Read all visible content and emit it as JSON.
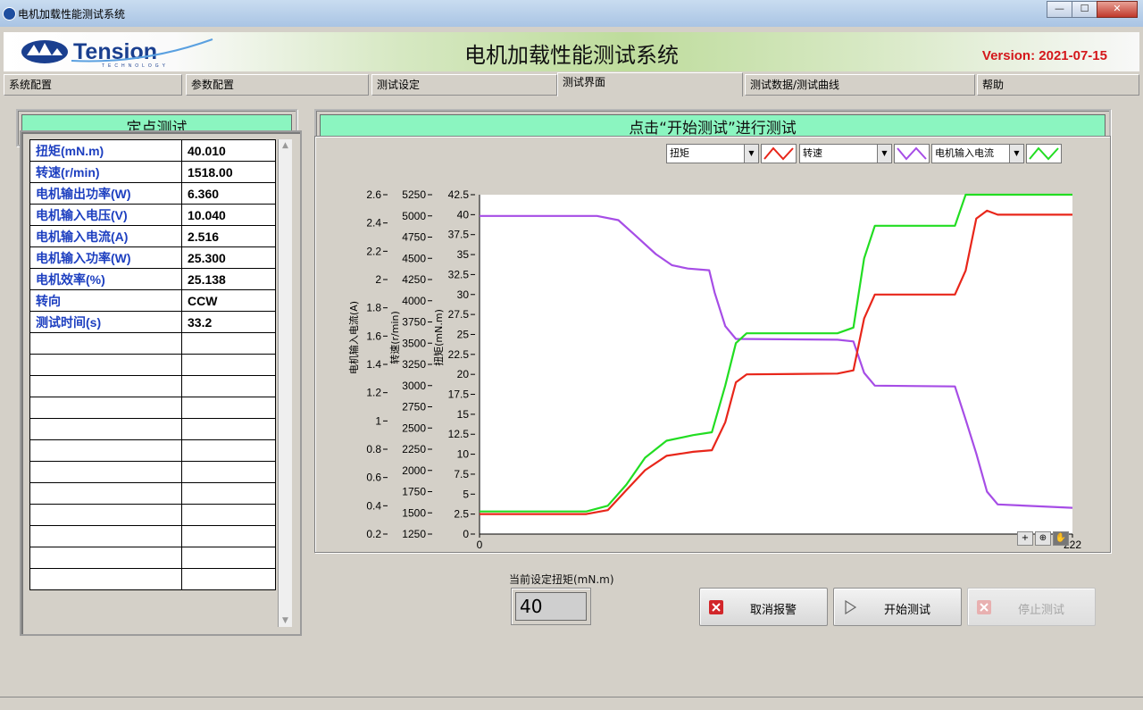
{
  "window": {
    "title": "电机加载性能测试系统",
    "min": "—",
    "max": "☐",
    "close": "✕"
  },
  "header": {
    "logo_text": "Tension",
    "logo_sub": "TECHNOLOGY",
    "title": "电机加载性能测试系统",
    "version": "Version: 2021-07-15"
  },
  "tabs": [
    "系统配置",
    "参数配置",
    "测试设定",
    "测试界面",
    "测试数据/测试曲线",
    "帮助"
  ],
  "active_tab": "测试界面",
  "left_panel": {
    "title": "定点测试"
  },
  "right_panel": {
    "title": "点击“开始测试”进行测试"
  },
  "table": {
    "rows": [
      {
        "label": "扭矩(mN.m)",
        "value": "40.010"
      },
      {
        "label": "转速(r/min)",
        "value": "1518.00"
      },
      {
        "label": "电机输出功率(W)",
        "value": "6.360"
      },
      {
        "label": "电机输入电压(V)",
        "value": "10.040"
      },
      {
        "label": "电机输入电流(A)",
        "value": "2.516"
      },
      {
        "label": "电机输入功率(W)",
        "value": "25.300"
      },
      {
        "label": "电机效率(%)",
        "value": "25.138"
      },
      {
        "label": "转向",
        "value": "CCW"
      },
      {
        "label": "测试时间(s)",
        "value": "33.2"
      }
    ],
    "empty_rows": 12
  },
  "chart_data": {
    "type": "line",
    "x_range": [
      0,
      222
    ],
    "x_tick_labels": [
      "0",
      "222"
    ],
    "axes": [
      {
        "label": "扭矩(mN.m)",
        "range": [
          0,
          42.5
        ],
        "ticks": [
          "0",
          "2.5",
          "5",
          "7.5",
          "10",
          "12.5",
          "15",
          "17.5",
          "20",
          "22.5",
          "25",
          "27.5",
          "30",
          "32.5",
          "35",
          "37.5",
          "40",
          "42.5"
        ]
      },
      {
        "label": "转速(r/min)",
        "range": [
          1250,
          5250
        ],
        "ticks": [
          "1250",
          "1500",
          "1750",
          "2000",
          "2250",
          "2500",
          "2750",
          "3000",
          "3250",
          "3500",
          "3750",
          "4000",
          "4250",
          "4500",
          "4750",
          "5000",
          "5250"
        ]
      },
      {
        "label": "电机输入电流(A)",
        "range": [
          0.2,
          2.6
        ],
        "ticks": [
          "0.2",
          "0.4",
          "0.6",
          "0.8",
          "1",
          "1.2",
          "1.4",
          "1.6",
          "1.8",
          "2",
          "2.2",
          "2.4",
          "2.6"
        ]
      }
    ],
    "legend": [
      {
        "name": "扭矩",
        "color": "#e8261a"
      },
      {
        "name": "转速",
        "color": "#a64de6"
      },
      {
        "name": "电机输入电流",
        "color": "#22dd22"
      }
    ],
    "series": [
      {
        "name": "扭矩",
        "color": "#e8261a",
        "axis": 0,
        "points": [
          [
            0,
            2.5
          ],
          [
            40,
            2.5
          ],
          [
            48,
            3.0
          ],
          [
            55,
            5.5
          ],
          [
            62,
            8.0
          ],
          [
            70,
            9.8
          ],
          [
            80,
            10.3
          ],
          [
            87,
            10.5
          ],
          [
            92,
            14
          ],
          [
            96,
            19
          ],
          [
            100,
            20
          ],
          [
            134,
            20.1
          ],
          [
            140,
            20.5
          ],
          [
            144,
            27
          ],
          [
            148,
            30
          ],
          [
            178,
            30
          ],
          [
            182,
            33
          ],
          [
            186,
            39.5
          ],
          [
            190,
            40.5
          ],
          [
            194,
            40
          ],
          [
            222,
            40
          ]
        ]
      },
      {
        "name": "转速",
        "color": "#a64de6",
        "axis": 1,
        "points": [
          [
            0,
            5000
          ],
          [
            44,
            5000
          ],
          [
            52,
            4950
          ],
          [
            58,
            4780
          ],
          [
            66,
            4550
          ],
          [
            72,
            4420
          ],
          [
            78,
            4380
          ],
          [
            86,
            4360
          ],
          [
            88,
            4100
          ],
          [
            92,
            3700
          ],
          [
            96,
            3550
          ],
          [
            134,
            3540
          ],
          [
            140,
            3520
          ],
          [
            144,
            3150
          ],
          [
            148,
            3000
          ],
          [
            178,
            2990
          ],
          [
            182,
            2600
          ],
          [
            186,
            2200
          ],
          [
            190,
            1750
          ],
          [
            194,
            1600
          ],
          [
            222,
            1560
          ]
        ]
      },
      {
        "name": "电机输入电流",
        "color": "#22dd22",
        "axis": 2,
        "points": [
          [
            0,
            0.36
          ],
          [
            40,
            0.36
          ],
          [
            48,
            0.4
          ],
          [
            55,
            0.55
          ],
          [
            62,
            0.74
          ],
          [
            70,
            0.86
          ],
          [
            80,
            0.9
          ],
          [
            87,
            0.92
          ],
          [
            92,
            1.25
          ],
          [
            96,
            1.55
          ],
          [
            100,
            1.62
          ],
          [
            134,
            1.62
          ],
          [
            140,
            1.66
          ],
          [
            144,
            2.15
          ],
          [
            148,
            2.38
          ],
          [
            178,
            2.38
          ],
          [
            182,
            2.6
          ],
          [
            186,
            2.9
          ],
          [
            190,
            3.0
          ],
          [
            194,
            2.98
          ],
          [
            222,
            2.98
          ]
        ]
      }
    ]
  },
  "set_torque": {
    "label": "当前设定扭矩(mN.m)",
    "value": "40"
  },
  "buttons": {
    "cancel_alarm": "取消报警",
    "start": "开始测试",
    "stop": "停止测试"
  },
  "tools": {
    "cursor": "+",
    "zoom": "⊕",
    "pan": "✋"
  }
}
